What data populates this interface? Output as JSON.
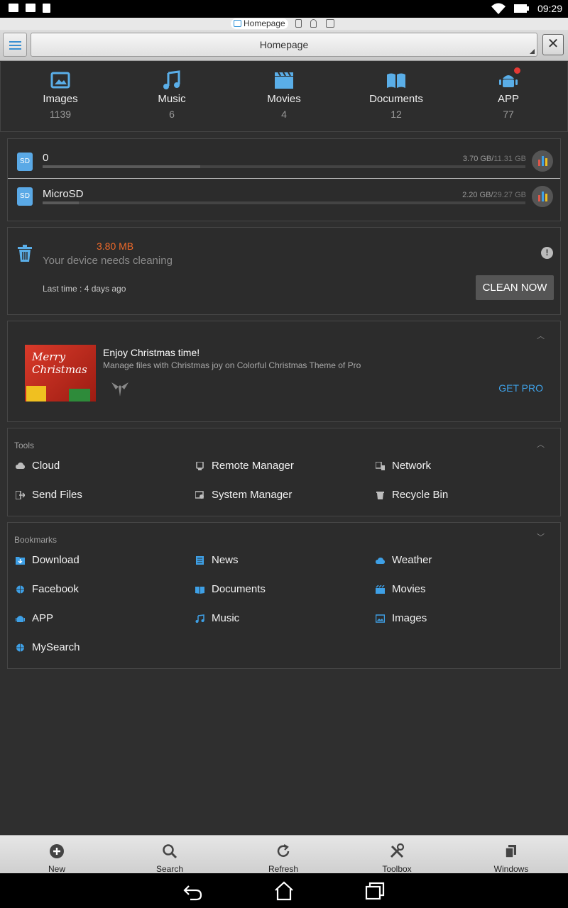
{
  "status_bar": {
    "time": "09:29"
  },
  "tabs": {
    "active_label": "Homepage"
  },
  "toolbar": {
    "address": "Homepage",
    "close_glyph": "✕"
  },
  "categories": [
    {
      "name": "Images",
      "count": "1139",
      "icon": "image-icon"
    },
    {
      "name": "Music",
      "count": "6",
      "icon": "music-note-icon"
    },
    {
      "name": "Movies",
      "count": "4",
      "icon": "clapperboard-icon"
    },
    {
      "name": "Documents",
      "count": "12",
      "icon": "book-icon"
    },
    {
      "name": "APP",
      "count": "77",
      "icon": "android-icon"
    }
  ],
  "storage": [
    {
      "name": "0",
      "used": "3.70 GB",
      "total": "11.31 GB",
      "sd_label": "SD",
      "used_fraction": 0.327
    },
    {
      "name": "MicroSD",
      "used": "2.20 GB",
      "total": "29.27 GB",
      "sd_label": "SD",
      "used_fraction": 0.075
    }
  ],
  "cleaner": {
    "size": "3.80 MB",
    "message": "Your device needs cleaning",
    "last_time": "Last time : 4 days ago",
    "button": "CLEAN NOW",
    "info_glyph": "!"
  },
  "promo": {
    "title": "Enjoy Christmas time!",
    "subtitle": "Manage files with Christmas joy on Colorful Christmas Theme of Pro",
    "image_text_1": "Merry",
    "image_text_2": "Christmas",
    "cta": "GET PRO"
  },
  "tools": {
    "title": "Tools",
    "items": [
      {
        "label": "Cloud",
        "icon": "cloud-icon"
      },
      {
        "label": "Remote Manager",
        "icon": "remote-icon"
      },
      {
        "label": "Network",
        "icon": "network-icon"
      },
      {
        "label": "Send Files",
        "icon": "send-icon"
      },
      {
        "label": "System Manager",
        "icon": "system-manager-icon"
      },
      {
        "label": "Recycle Bin",
        "icon": "trash-icon"
      }
    ]
  },
  "bookmarks": {
    "title": "Bookmarks",
    "items": [
      {
        "label": "Download",
        "icon": "download-folder-icon"
      },
      {
        "label": "News",
        "icon": "news-icon"
      },
      {
        "label": "Weather",
        "icon": "weather-icon"
      },
      {
        "label": "Facebook",
        "icon": "globe-icon"
      },
      {
        "label": "Documents",
        "icon": "book-icon"
      },
      {
        "label": "Movies",
        "icon": "movies-icon"
      },
      {
        "label": "APP",
        "icon": "android-icon"
      },
      {
        "label": "Music",
        "icon": "music-note-icon"
      },
      {
        "label": "Images",
        "icon": "image-icon"
      },
      {
        "label": "MySearch",
        "icon": "globe-icon"
      }
    ]
  },
  "actions": [
    {
      "label": "New",
      "icon": "plus-circle-icon"
    },
    {
      "label": "Search",
      "icon": "search-icon"
    },
    {
      "label": "Refresh",
      "icon": "refresh-icon"
    },
    {
      "label": "Toolbox",
      "icon": "tools-icon"
    },
    {
      "label": "Windows",
      "icon": "windows-icon"
    }
  ],
  "colors": {
    "accent": "#3ea0e6",
    "warning": "#f06a2a",
    "background": "#2f2f2f"
  }
}
